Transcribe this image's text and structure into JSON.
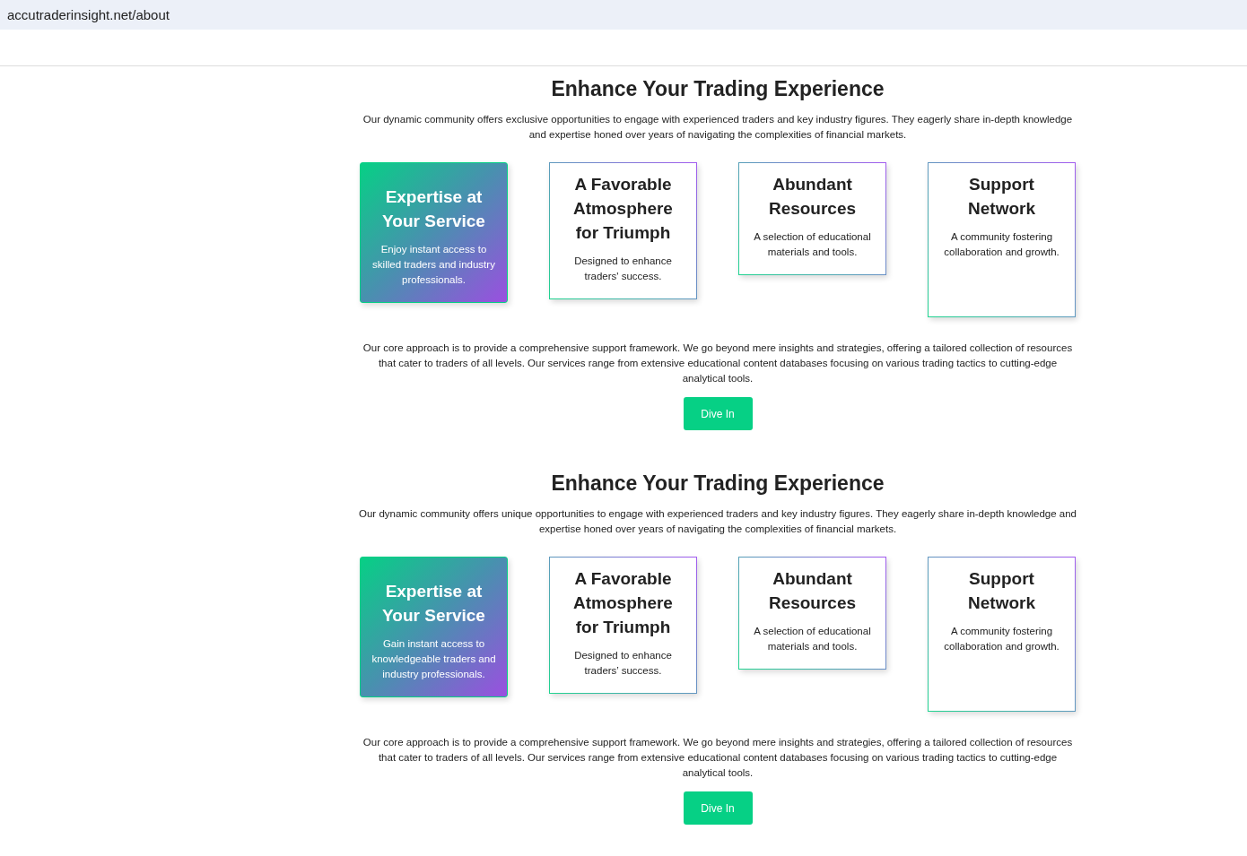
{
  "address_bar": {
    "url": "accutraderinsight.net/about"
  },
  "sections": [
    {
      "title": "Enhance Your Trading Experience",
      "intro": "Our dynamic community offers exclusive opportunities to engage with experienced traders and key industry figures. They eagerly share in-depth knowledge and expertise honed over years of navigating the complexities of financial markets.",
      "cards": [
        {
          "kind": "featured",
          "title": "Expertise at Your Service",
          "text": "Enjoy instant access to skilled traders and industry professionals."
        },
        {
          "kind": "outlined",
          "title": "A Favorable Atmosphere for Triumph",
          "text": "Designed to enhance traders' success."
        },
        {
          "kind": "outlined",
          "title": "Abundant Resources",
          "text": "A selection of educational materials and tools."
        },
        {
          "kind": "outlined",
          "title": "Support Network",
          "text": "A community fostering collaboration and growth."
        }
      ],
      "body": "Our core approach is to provide a comprehensive support framework. We go beyond mere insights and strategies, offering a tailored collection of resources that cater to traders of all levels. Our services range from extensive educational content databases focusing on various trading tactics to cutting-edge analytical tools.",
      "button": "Dive In"
    },
    {
      "title": "Enhance Your Trading Experience",
      "intro": "Our dynamic community offers unique opportunities to engage with experienced traders and key industry figures. They eagerly share in-depth knowledge and expertise honed over years of navigating the complexities of financial markets.",
      "cards": [
        {
          "kind": "featured",
          "title": "Expertise at Your Service",
          "text": "Gain instant access to knowledgeable traders and industry professionals."
        },
        {
          "kind": "outlined",
          "title": "A Favorable Atmosphere for Triumph",
          "text": "Designed to enhance traders’ success."
        },
        {
          "kind": "outlined",
          "title": "Abundant Resources",
          "text": "A selection of educational materials and tools."
        },
        {
          "kind": "outlined",
          "title": "Support Network",
          "text": "A community fostering collaboration and growth."
        }
      ],
      "body": "Our core approach is to provide a comprehensive support framework. We go beyond mere insights and strategies, offering a tailored collection of resources that cater to traders of all levels. Our services range from extensive educational content databases focusing on various trading tactics to cutting-edge analytical tools.",
      "button": "Dive In"
    }
  ]
}
